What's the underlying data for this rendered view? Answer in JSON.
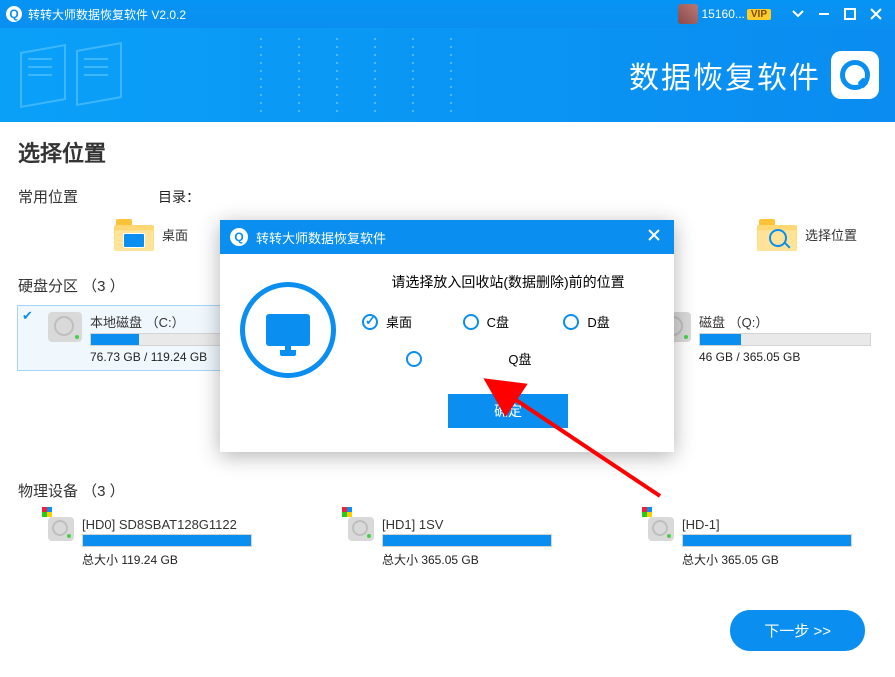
{
  "titlebar": {
    "app_title": "转转大师数据恢复软件 V2.0.2",
    "uid": "15160...",
    "vip": "VIP"
  },
  "banner": {
    "title": "数据恢复软件"
  },
  "page": {
    "h1": "选择位置",
    "common_label": "常用位置",
    "dir_label": "目录：",
    "desktop": "桌面",
    "choose_location": "选择位置",
    "partitions_label": "硬盘分区 （3 ）",
    "devices_label": "物理设备 （3 ）",
    "next": "下一步 >>"
  },
  "partitions": [
    {
      "name": "本地磁盘 （C:）",
      "size": "76.73 GB / 119.24 GB",
      "fill": 28,
      "selected": true
    },
    {
      "name": "磁盘 （Q:）",
      "size": "46 GB / 365.05 GB",
      "fill": 24,
      "selected": false
    }
  ],
  "devices": [
    {
      "name": "[HD0] SD8SBAT128G1122",
      "size": "总大小 119.24 GB"
    },
    {
      "name": "[HD1] 1SV",
      "size": "总大小 365.05 GB"
    },
    {
      "name": "[HD-1]",
      "size": "总大小 365.05 GB"
    }
  ],
  "modal": {
    "title": "转转大师数据恢复软件",
    "msg": "请选择放入回收站(数据删除)前的位置",
    "options": [
      "桌面",
      "C盘",
      "D盘",
      "Q盘"
    ],
    "selected": "桌面",
    "confirm": "确定"
  }
}
